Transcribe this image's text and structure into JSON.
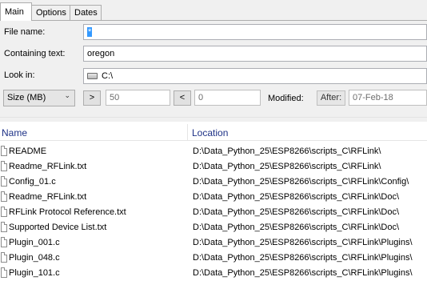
{
  "tabs": [
    {
      "label": "Main",
      "active": true
    },
    {
      "label": "Options",
      "active": false
    },
    {
      "label": "Dates",
      "active": false
    }
  ],
  "form": {
    "file_name_label": "File name:",
    "file_name_value": "*",
    "containing_text_label": "Containing text:",
    "containing_text_value": "oregon",
    "look_in_label": "Look in:",
    "look_in_value": "C:\\",
    "size_unit": "Size (MB)",
    "greater_button": ">",
    "greater_value": "50",
    "less_button": "<",
    "less_value": "0",
    "modified_label": "Modified:",
    "after_button": "After:",
    "after_value": "07-Feb-18"
  },
  "results": {
    "columns": [
      "Name",
      "Location"
    ],
    "rows": [
      {
        "name": "README",
        "location": "D:\\Data_Python_25\\ESP8266\\scripts_C\\RFLink\\"
      },
      {
        "name": "Readme_RFLink.txt",
        "location": "D:\\Data_Python_25\\ESP8266\\scripts_C\\RFLink\\"
      },
      {
        "name": "Config_01.c",
        "location": "D:\\Data_Python_25\\ESP8266\\scripts_C\\RFLink\\Config\\"
      },
      {
        "name": "Readme_RFLink.txt",
        "location": "D:\\Data_Python_25\\ESP8266\\scripts_C\\RFLink\\Doc\\"
      },
      {
        "name": "RFLink Protocol Reference.txt",
        "location": "D:\\Data_Python_25\\ESP8266\\scripts_C\\RFLink\\Doc\\"
      },
      {
        "name": "Supported Device List.txt",
        "location": "D:\\Data_Python_25\\ESP8266\\scripts_C\\RFLink\\Doc\\"
      },
      {
        "name": "Plugin_001.c",
        "location": "D:\\Data_Python_25\\ESP8266\\scripts_C\\RFLink\\Plugins\\"
      },
      {
        "name": "Plugin_048.c",
        "location": "D:\\Data_Python_25\\ESP8266\\scripts_C\\RFLink\\Plugins\\"
      },
      {
        "name": "Plugin_101.c",
        "location": "D:\\Data_Python_25\\ESP8266\\scripts_C\\RFLink\\Plugins\\"
      }
    ]
  },
  "icons": {
    "drive": "drive-icon",
    "file": "file-icon",
    "combo_arrow": "chevron-down-icon"
  }
}
